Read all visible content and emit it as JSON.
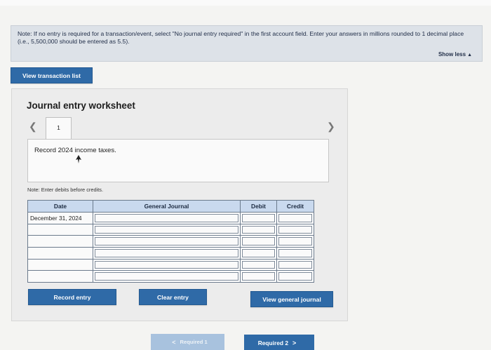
{
  "note": {
    "text": "Note: If no entry is required for a transaction/event, select \"No journal entry required\" in the first account field. Enter your answers in millions rounded to 1 decimal place (i.e., 5,500,000 should be entered as 5.5).",
    "show_less_label": "Show less",
    "show_less_icon": "triangle-up-icon"
  },
  "buttons": {
    "view_transaction_list": "View transaction list",
    "record_entry": "Record entry",
    "clear_entry": "Clear entry",
    "view_general_journal": "View general journal"
  },
  "worksheet": {
    "title": "Journal entry worksheet",
    "current_tab": "1",
    "record_text": "Record 2024 income taxes.",
    "note": "Note: Enter debits before credits."
  },
  "table": {
    "headers": [
      "Date",
      "General Journal",
      "Debit",
      "Credit"
    ],
    "rows": [
      [
        "December 31, 2024",
        "",
        "",
        ""
      ],
      [
        "",
        "",
        "",
        ""
      ],
      [
        "",
        "",
        "",
        ""
      ],
      [
        "",
        "",
        "",
        ""
      ],
      [
        "",
        "",
        "",
        ""
      ],
      [
        "",
        "",
        "",
        ""
      ]
    ]
  },
  "pagination": {
    "prev_label": "Required 1",
    "next_label": "Required 2"
  },
  "colors": {
    "accent": "#2f6aa7",
    "banner": "#dde2e8",
    "table_header": "#c9d9ee"
  }
}
